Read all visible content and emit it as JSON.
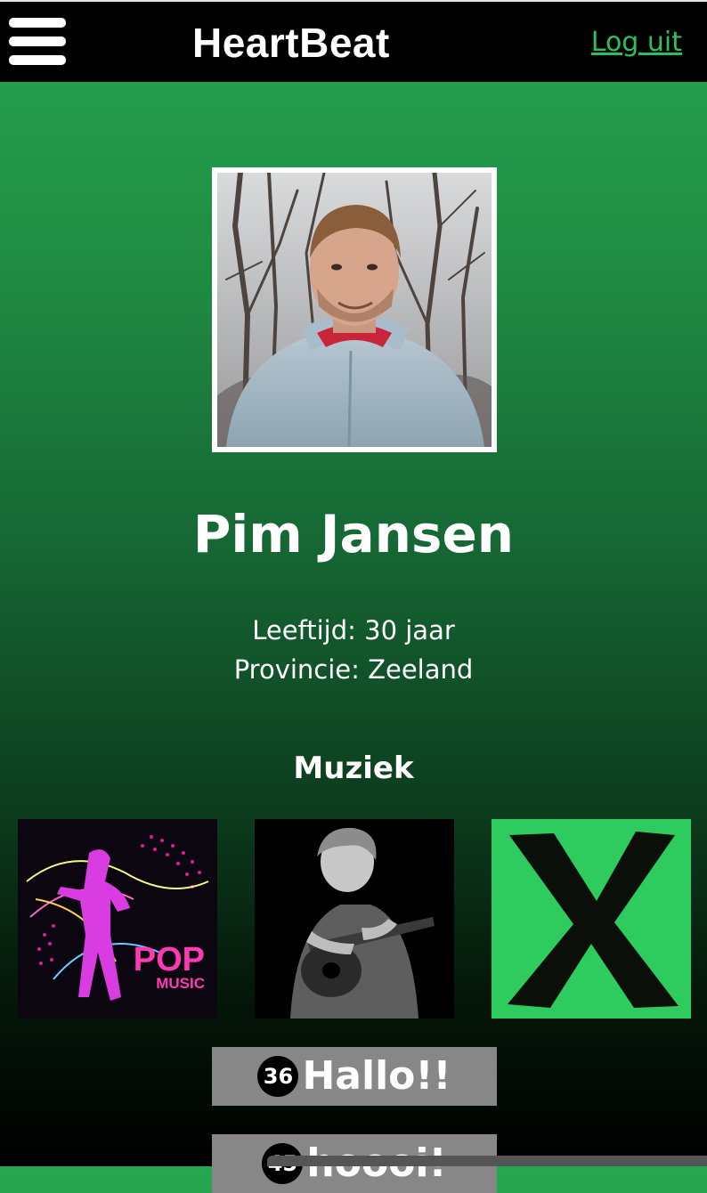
{
  "header": {
    "title": "HeartBeat",
    "logout_label": "Log uit",
    "menu_icon": "hamburger-menu-icon"
  },
  "profile": {
    "name": "Pim Jansen",
    "age_text": "Leeftijd: 30 jaar",
    "province_text": "Provincie: Zeeland"
  },
  "music": {
    "title": "Muziek",
    "albums": [
      {
        "label_line1": "POP",
        "label_line2": "MUSIC"
      },
      {
        "label": ""
      },
      {
        "label": "X"
      }
    ]
  },
  "messages": [
    {
      "count": "36",
      "text": "Hallo!!"
    },
    {
      "count": "45",
      "text": "hoooi!"
    }
  ],
  "colors": {
    "accent_green": "#2fbf5a",
    "album_green": "#2ecc5f",
    "topbar": "#000000",
    "message_button": "#878787"
  }
}
